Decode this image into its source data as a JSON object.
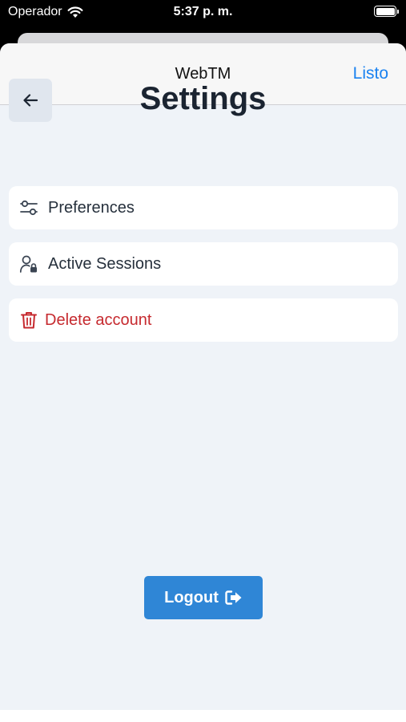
{
  "status_bar": {
    "carrier": "Operador",
    "time": "5:37 p. m.",
    "battery_level": 1.0
  },
  "nav": {
    "title": "WebTM",
    "done_label": "Listo"
  },
  "page": {
    "title": "Settings"
  },
  "menu": {
    "items": [
      {
        "label": "Preferences",
        "icon": "sliders-icon"
      },
      {
        "label": "Active Sessions",
        "icon": "user-lock-icon"
      },
      {
        "label": "Delete account",
        "icon": "trash-icon"
      }
    ]
  },
  "logout": {
    "label": "Logout",
    "icon": "sign-out-icon"
  },
  "colors": {
    "accent": "#1a82f0",
    "button": "#2f86d6",
    "danger": "#c62a2f",
    "background": "#eff3f8"
  }
}
